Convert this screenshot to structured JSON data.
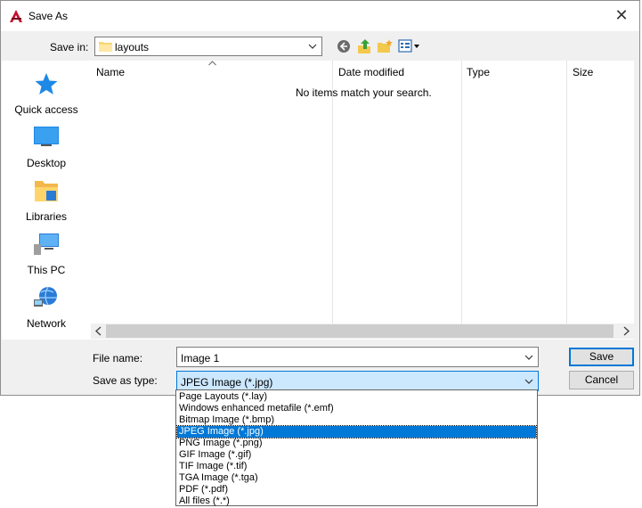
{
  "window": {
    "title": "Save As",
    "close_label": "✕"
  },
  "toolbar": {
    "save_in_label": "Save in:",
    "save_in_value": "layouts",
    "buttons": [
      "back-icon",
      "up-folder-icon",
      "new-folder-icon",
      "view-menu-icon"
    ]
  },
  "places": [
    {
      "label": "Quick access",
      "icon": "star-icon"
    },
    {
      "label": "Desktop",
      "icon": "desktop-icon"
    },
    {
      "label": "Libraries",
      "icon": "libraries-icon"
    },
    {
      "label": "This PC",
      "icon": "computer-icon"
    },
    {
      "label": "Network",
      "icon": "network-icon"
    }
  ],
  "filelist": {
    "columns": [
      "Name",
      "Date modified",
      "Type",
      "Size"
    ],
    "empty_message": "No items match your search."
  },
  "form": {
    "file_name_label": "File name:",
    "file_name_value": "Image 1",
    "type_label": "Save as type:",
    "type_value": "JPEG Image (*.jpg)"
  },
  "buttons": {
    "save": "Save",
    "cancel": "Cancel"
  },
  "type_options": [
    "Page Layouts (*.lay)",
    "Windows enhanced metafile (*.emf)",
    "Bitmap Image (*.bmp)",
    "JPEG Image (*.jpg)",
    "PNG Image (*.png)",
    "GIF Image (*.gif)",
    "TIF Image (*.tif)",
    "TGA Image (*.tga)",
    "PDF (*.pdf)",
    "All files (*.*)"
  ],
  "colors": {
    "accent": "#0078d7",
    "selection_bg": "#cce8ff"
  }
}
